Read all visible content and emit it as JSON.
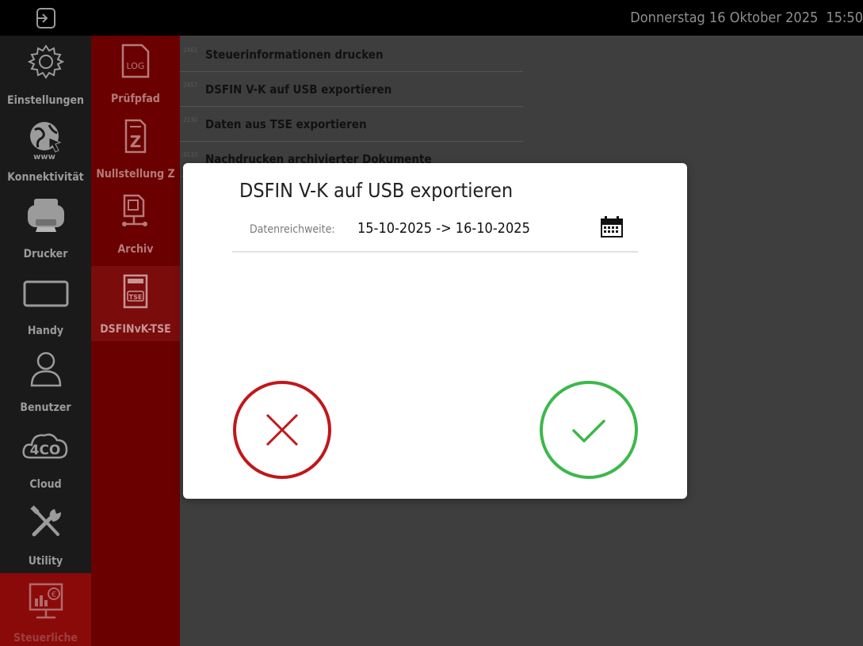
{
  "header": {
    "logout_icon": "logout-icon",
    "date": "Donnerstag 16 Oktober 2025",
    "time": "15:50"
  },
  "sidebar": {
    "items": [
      {
        "label": "Einstellungen",
        "icon": "gear-icon"
      },
      {
        "label": "Konnektivität",
        "icon": "globe-www-icon"
      },
      {
        "label": "Drucker",
        "icon": "printer-icon"
      },
      {
        "label": "Handy",
        "icon": "tablet-icon"
      },
      {
        "label": "Benutzer",
        "icon": "user-icon"
      },
      {
        "label": "Cloud",
        "icon": "cloud-4co-icon"
      },
      {
        "label": "Utility",
        "icon": "tools-icon"
      },
      {
        "label": "Steuerliche",
        "icon": "fiscal-monitor-icon"
      }
    ]
  },
  "subnav": {
    "items": [
      {
        "label": "Prüfpfad",
        "icon": "log-file-icon",
        "badge": "LOG"
      },
      {
        "label": "Nullstellung Z",
        "icon": "z-report-icon",
        "badge": "Z"
      },
      {
        "label": "Archiv",
        "icon": "archive-icon"
      },
      {
        "label": "DSFINvK-TSE",
        "icon": "tse-card-icon",
        "badge": "TSE"
      }
    ]
  },
  "list": {
    "rows": [
      {
        "code": "2461",
        "name": "Steuerinformationen drucken"
      },
      {
        "code": "2457",
        "name": "DSFIN V-K auf USB exportieren"
      },
      {
        "code": "2130",
        "name": "Daten aus TSE exportieren"
      },
      {
        "code": "4133",
        "name": "Nachdrucken archivierter Dokumente"
      }
    ]
  },
  "dialog": {
    "title": "DSFIN V-K auf USB exportieren",
    "range_label": "Datenreichweite:",
    "range_value": "15-10-2025 -> 16-10-2025",
    "calendar_icon": "calendar-icon",
    "cancel_icon": "cancel-x-icon",
    "confirm_icon": "confirm-check-icon"
  },
  "colors": {
    "cancel": "#c0171b",
    "confirm": "#3cb84a",
    "sidebar_bg": "#1a1a1a",
    "subnav_bg": "#6a0000",
    "active_bg": "#8a0a0a"
  }
}
